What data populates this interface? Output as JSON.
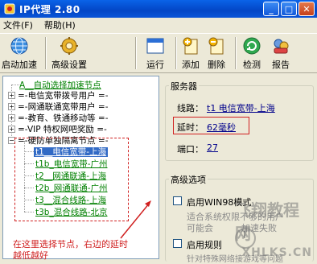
{
  "window": {
    "title": "IP代理 2.80"
  },
  "menu": {
    "file": "文件(F)",
    "help": "帮助(H)"
  },
  "toolbar": {
    "start": "启动加速",
    "advanced": "高级设置",
    "run": "运行",
    "add": "添加",
    "delete": "删除",
    "detect": "检测",
    "report": "报告"
  },
  "tree": {
    "auto": "A__自动选择加速节点",
    "group1": "=-电信宽带拨号用户 =-",
    "group2": "=-网通联通宽带用户 =-",
    "group3": "=-教育、铁通移动等 =-",
    "group4": "=-VIP 特权网吧奖励 =-",
    "group5": "=-硬防单独隔离节点 =-",
    "items": [
      "t1__电信宽带-上海",
      "t1b_电信宽带-广州",
      "t2__网通联通-上海",
      "t2b_网通联通-广州",
      "t3__混合线路-上海",
      "t3b_混合线路-北京"
    ]
  },
  "annotation": {
    "line1": "在这里选择节点，右边的延时",
    "line2": "越低越好"
  },
  "server": {
    "group_label": "服务器",
    "line_label": "线路：",
    "line_value": "t1 电信宽带-上海",
    "delay_label": "延时：",
    "delay_value": "62毫秒",
    "port_label": "端口：",
    "port_value": "27"
  },
  "advanced": {
    "group_label": "高级选项",
    "win98_label": "启用WIN98模式",
    "win98_desc1": "适合系统权限不够的用户",
    "win98_desc2": "可能会",
    "win98_desc3": "加速失败",
    "rule_label": "启用",
    "rule_label2": "启用规则",
    "rule_desc": "针对特殊网络接游戏等问题"
  },
  "watermark": {
    "top": "飞翔教程网",
    "bottom": "XHLKS.CN"
  }
}
